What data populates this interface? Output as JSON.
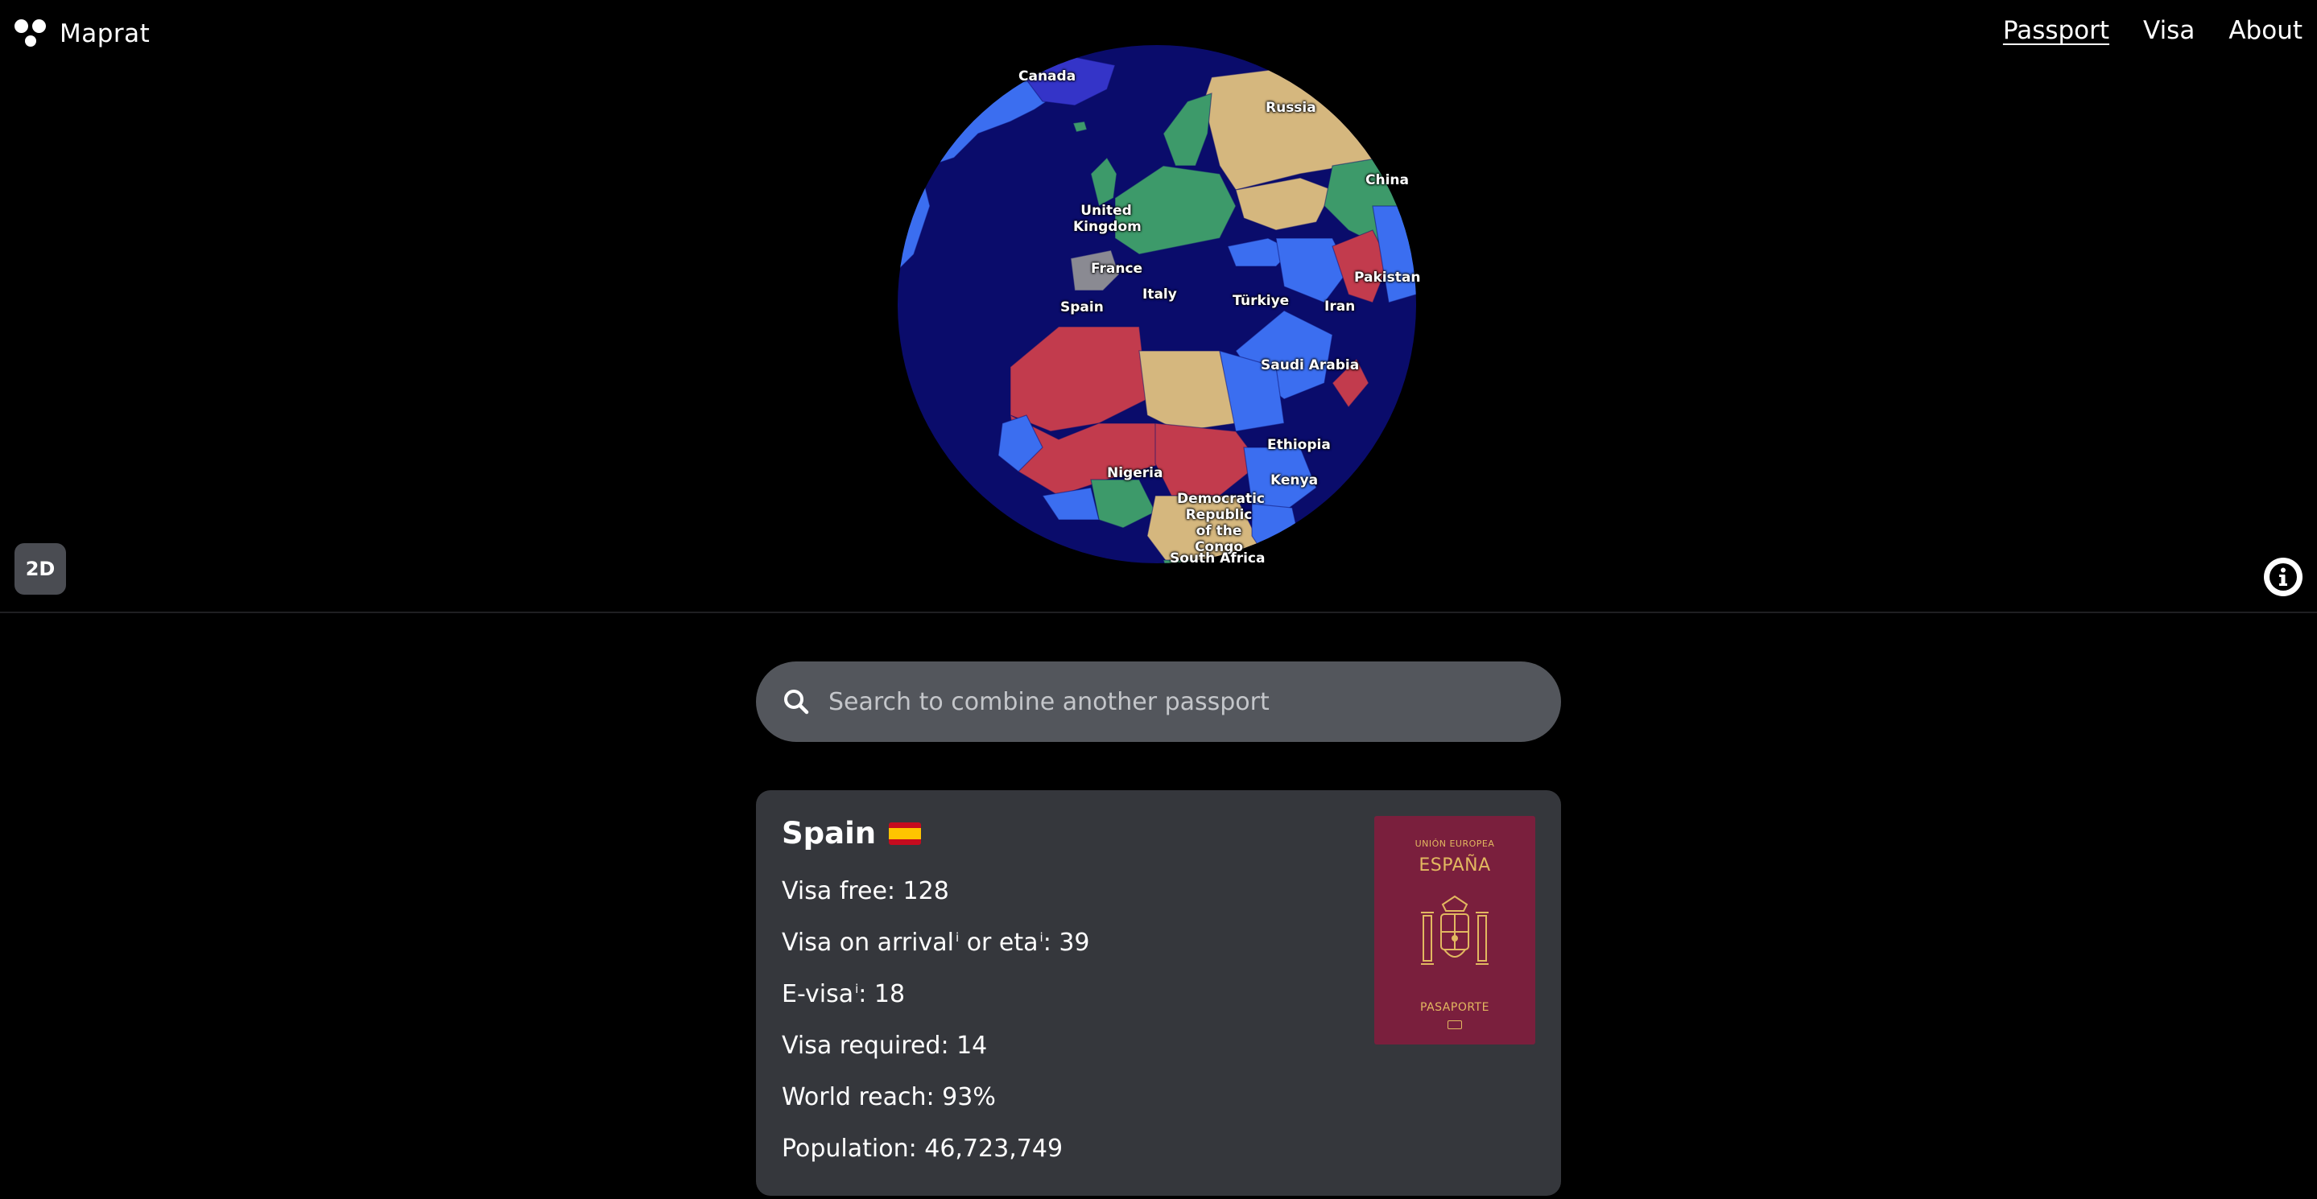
{
  "app": {
    "name": "Maprat"
  },
  "nav": {
    "passport": "Passport",
    "visa": "Visa",
    "about": "About"
  },
  "map": {
    "toggle_label": "2D",
    "labels": {
      "canada": "Canada",
      "russia": "Russia",
      "china": "China",
      "uk": "United Kingdom",
      "france": "France",
      "spain": "Spain",
      "italy": "Italy",
      "turkiye": "Türkiye",
      "iran": "Iran",
      "pakistan": "Pakistan",
      "saudi": "Saudi Arabia",
      "ethiopia": "Ethiopia",
      "nigeria": "Nigeria",
      "kenya": "Kenya",
      "drc": "Democratic Republic of the Congo",
      "south_africa": "South Africa"
    },
    "colors": {
      "ocean": "#0a0c6b",
      "visa_free": "#3d9a6a",
      "visa_on_arrival": "#3b6ef0",
      "e_visa": "#d5b77e",
      "visa_required": "#c23b4d",
      "selected": "#8a8a92"
    }
  },
  "search": {
    "placeholder": "Search to combine another passport"
  },
  "passport": {
    "country": "Spain",
    "visa_free": "Visa free: 128",
    "visa_on_arrival_prefix": "Visa on arrival",
    "visa_on_arrival_mid": " or eta",
    "visa_on_arrival_suffix": ": 39",
    "info_marker": "i",
    "evisa_prefix": "E-visa",
    "evisa_suffix": ": 18",
    "visa_required": "Visa required: 14",
    "world_reach": "World reach: 93%",
    "population": "Population: 46,723,749",
    "cover": {
      "top": "UNIÓN EUROPEA",
      "country": "ESPAÑA",
      "bottom": "PASAPORTE"
    }
  }
}
